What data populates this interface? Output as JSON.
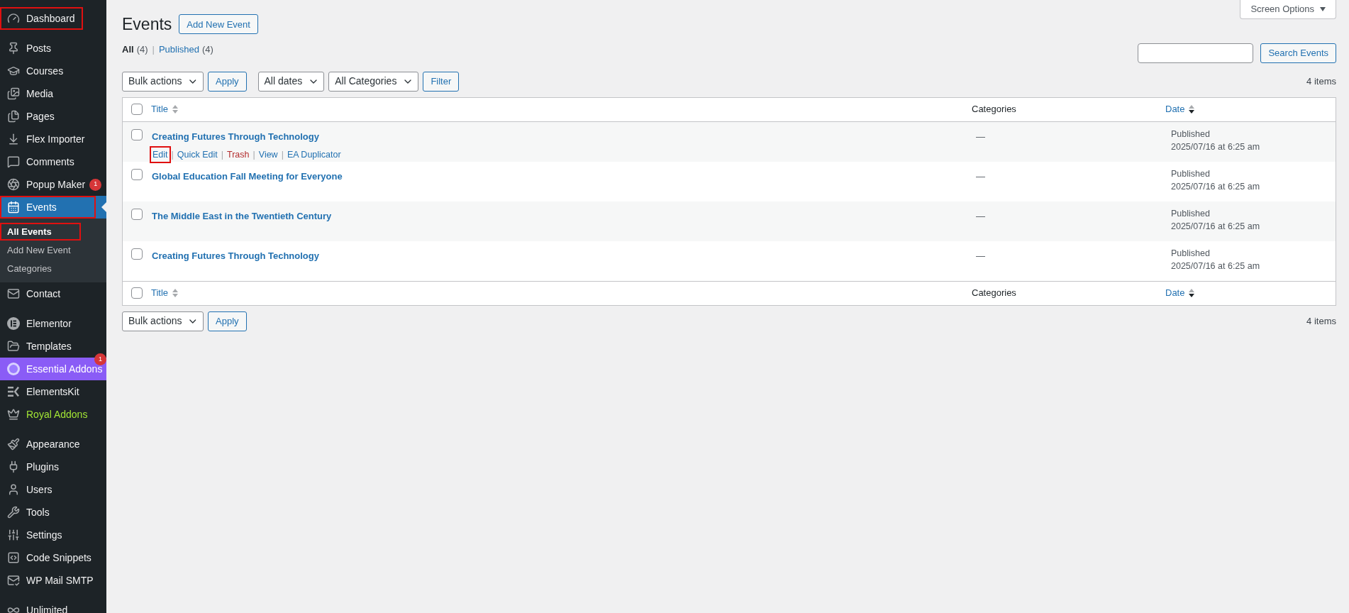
{
  "sidebar": {
    "groups": [
      [
        {
          "label": "Dashboard",
          "kind": "standard",
          "selected": false,
          "highlighted": true
        }
      ],
      [
        {
          "label": "Posts",
          "kind": "standard",
          "selected": false,
          "highlighted": false
        },
        {
          "label": "Courses",
          "kind": "standard",
          "selected": false,
          "highlighted": false
        },
        {
          "label": "Media",
          "kind": "standard",
          "selected": false,
          "highlighted": false
        },
        {
          "label": "Pages",
          "kind": "standard",
          "selected": false,
          "highlighted": false
        },
        {
          "label": "Flex Importer",
          "kind": "standard",
          "selected": false,
          "highlighted": false
        },
        {
          "label": "Comments",
          "kind": "standard",
          "selected": false,
          "highlighted": false
        },
        {
          "label": "Popup Maker",
          "kind": "standard",
          "selected": false,
          "highlighted": false,
          "badge": "1"
        },
        {
          "label": "Events",
          "kind": "standard",
          "selected": true,
          "highlighted": true,
          "children": [
            {
              "label": "All Events",
              "selected": true,
              "highlighted": true
            },
            {
              "label": "Add New Event",
              "selected": false,
              "highlighted": false
            },
            {
              "label": "Categories",
              "selected": false,
              "highlighted": false
            }
          ]
        },
        {
          "label": "Contact",
          "kind": "standard",
          "selected": false,
          "highlighted": false
        }
      ],
      [
        {
          "label": "Elementor",
          "kind": "standard",
          "selected": false,
          "highlighted": false
        },
        {
          "label": "Templates",
          "kind": "standard",
          "selected": false,
          "highlighted": false
        },
        {
          "label": "Essential Addons",
          "kind": "branded-fill",
          "selected": false,
          "highlighted": false,
          "badge": "1"
        },
        {
          "label": "ElementsKit",
          "kind": "standard",
          "selected": false,
          "highlighted": false
        },
        {
          "label": "Royal Addons",
          "kind": "branded-text",
          "selected": false,
          "highlighted": false
        }
      ],
      [
        {
          "label": "Appearance",
          "kind": "standard",
          "selected": false,
          "highlighted": false
        },
        {
          "label": "Plugins",
          "kind": "standard",
          "selected": false,
          "highlighted": false
        },
        {
          "label": "Users",
          "kind": "standard",
          "selected": false,
          "highlighted": false
        },
        {
          "label": "Tools",
          "kind": "standard",
          "selected": false,
          "highlighted": false
        },
        {
          "label": "Settings",
          "kind": "standard",
          "selected": false,
          "highlighted": false
        },
        {
          "label": "Code Snippets",
          "kind": "standard",
          "selected": false,
          "highlighted": false
        },
        {
          "label": "WP Mail SMTP",
          "kind": "standard",
          "selected": false,
          "highlighted": false
        }
      ],
      [
        {
          "label": "Unlimited",
          "kind": "standard",
          "selected": false,
          "highlighted": false
        }
      ]
    ]
  },
  "screen_options": "Screen Options",
  "page": {
    "title": "Events",
    "add_button": "Add New Event"
  },
  "views": [
    {
      "label": "All",
      "count": "(4)",
      "selected": true
    },
    {
      "separator": "|",
      "label": "Published",
      "count": "(4)",
      "selected": false
    }
  ],
  "search": {
    "button": "Search Events"
  },
  "top_toolbar": {
    "bulk_actions": "Bulk actions",
    "apply": "Apply",
    "date_filter": "All dates",
    "category_filter": "All Categories",
    "filter": "Filter",
    "count": "4 items"
  },
  "table": {
    "header": {
      "checked": false,
      "columns": [
        {
          "label": "Title",
          "sortable": true,
          "sorted_descending": false
        },
        {
          "label": "Categories",
          "sortable": false
        },
        {
          "label": "Date",
          "sortable": true,
          "sorted_descending": true
        }
      ]
    },
    "footer": {
      "checked": false,
      "columns": [
        {
          "label": "Title",
          "sortable": true,
          "sorted_descending": false
        },
        {
          "label": "Categories",
          "sortable": false
        },
        {
          "label": "Date",
          "sortable": true,
          "sorted_descending": true
        }
      ]
    },
    "rows": [
      {
        "checked": false,
        "title": "Creating Futures Through Technology",
        "categories": "—",
        "status": "Published",
        "date": "2025/07/16 at 6:25 am",
        "actions": [
          {
            "label": "Edit",
            "kind": "link",
            "highlighted": true
          },
          {
            "separator": "|",
            "label": "Quick Edit",
            "kind": "link",
            "highlighted": false
          },
          {
            "separator": "|",
            "label": "Trash",
            "kind": "danger",
            "highlighted": false
          },
          {
            "separator": "|",
            "label": "View",
            "kind": "link",
            "highlighted": false
          },
          {
            "separator": "|",
            "label": "EA Duplicator",
            "kind": "link",
            "highlighted": false
          }
        ]
      },
      {
        "checked": false,
        "title": "Global Education Fall Meeting for Everyone",
        "categories": "—",
        "status": "Published",
        "date": "2025/07/16 at 6:25 am"
      },
      {
        "checked": false,
        "title": "The Middle East in the Twentieth Century",
        "categories": "—",
        "status": "Published",
        "date": "2025/07/16 at 6:25 am"
      },
      {
        "checked": false,
        "title": "Creating Futures Through Technology",
        "categories": "—",
        "status": "Published",
        "date": "2025/07/16 at 6:25 am"
      }
    ]
  },
  "bottom_toolbar": {
    "bulk_actions": "Bulk actions",
    "apply": "Apply",
    "count": "4 items"
  }
}
